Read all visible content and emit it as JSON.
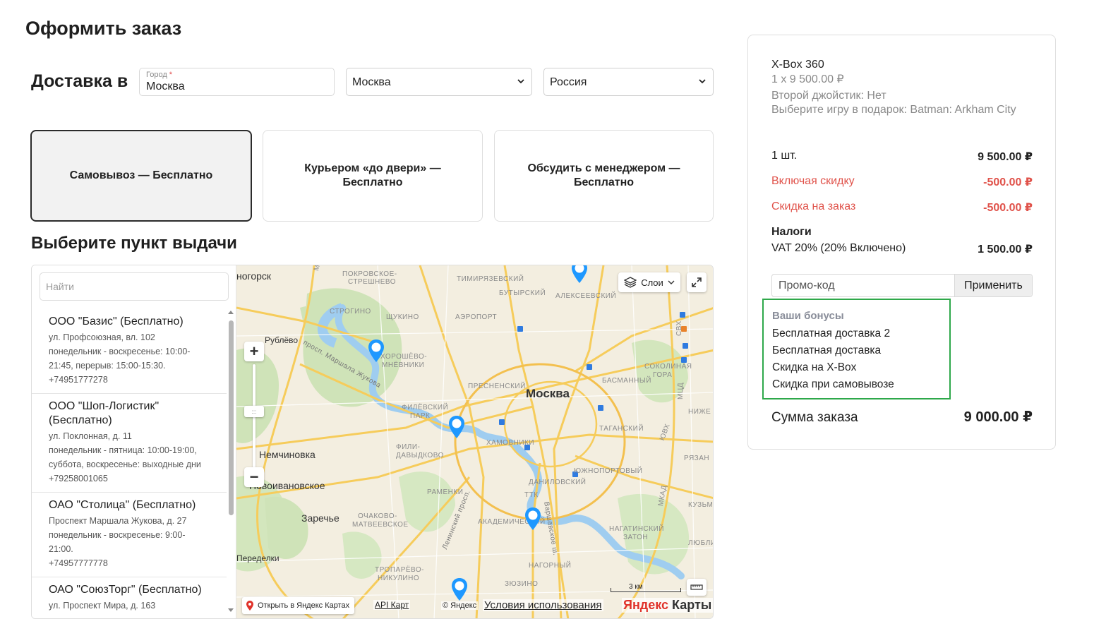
{
  "page_title": "Оформить заказ",
  "delivery": {
    "label": "Доставка в",
    "city_label": "Город",
    "city_required_mark": "*",
    "city_value": "Москва",
    "region_value": "Москва",
    "country_value": "Россия"
  },
  "delivery_options": [
    {
      "label": "Самовывоз — Бесплатно",
      "selected": true
    },
    {
      "label": "Курьером «до двери» — Бесплатно",
      "selected": false
    },
    {
      "label": "Обсудить с менеджером — Бесплатно",
      "selected": false
    }
  ],
  "pickup": {
    "title": "Выберите пункт выдачи",
    "search_placeholder": "Найти",
    "points": [
      {
        "name": "ООО \"Базис\" (Бесплатно)",
        "lines": [
          "ул. Профсоюзная, вл. 102",
          "понедельник - воскресенье: 10:00-",
          "21:45, перерыв: 15:00-15:30.",
          "+74951777278"
        ]
      },
      {
        "name": "ООО \"Шоп-Логистик\" (Бесплатно)",
        "lines": [
          "ул. Поклонная, д. 11",
          "понедельник - пятница: 10:00-19:00,",
          "суббота, воскресенье: выходные дни",
          "+79258001065"
        ]
      },
      {
        "name": "ОАО \"Столица\" (Бесплатно)",
        "lines": [
          "Проспект Маршала Жукова, д. 27",
          "понедельник - воскресенье: 9:00-",
          "21:00.",
          "+74957777778"
        ]
      },
      {
        "name": "ОАО \"СоюзТорг\" (Бесплатно)",
        "lines": [
          "ул. Проспект Мира, д. 163"
        ]
      }
    ]
  },
  "map": {
    "layers_label": "Слои",
    "zoom_in": "+",
    "zoom_out": "−",
    "open_in_yandex": "Открыть в Яндекс Картах",
    "api_link": "API Карт",
    "copyright": "© Яндекс",
    "terms": "Условия использования",
    "brand_y": "Яндекс",
    "brand_rest": " Карты",
    "scale_label": "3 км",
    "labels": {
      "city": "Москва",
      "nemchinovka": "Немчиновка",
      "novoivanovskoe": "Новоивановское",
      "zarechye": "Заречье",
      "rublevo": "Рублёво",
      "peredelki": "Переделки",
      "krasnogorsk": "ногорск",
      "mkad_west": "МКАД",
      "mkad_east": "МКАД",
      "pokrovskoe": "ПОКРОВСКОЕ-",
      "streshnevo": "СТРЕШНЕВО",
      "timiryazevsky": "ТИМИРЯЗЕВСКИЙ",
      "butyrsky": "БУТЫРСКИЙ",
      "alekseevsky": "АЛЕКСЕЕВСКИЙ",
      "strogino": "СТРОГИНО",
      "shchukino": "ЩУКИНО",
      "airport": "АЭРОПОРТ",
      "marshala_zhukova": "просп. Маршала Жукова",
      "horoshevo": "ХОРОШЁВО-",
      "mnevniki": "МНЁВНИКИ",
      "presnensky": "ПРЕСНЕНСКИЙ",
      "basmanny": "БАСМАННЫЙ",
      "sokolinaya": "СОКОЛИНАЯ",
      "gora": "ГОРА",
      "filevsky": "ФИЛЁВСКИЙ",
      "park": "ПАРК",
      "tagansky": "ТАГАНСКИЙ",
      "fili": "ФИЛИ-",
      "davydkovo": "ДАВЫДКОВО",
      "khamovniki": "ХАМОВНИКИ",
      "danilovsky": "ДАНИЛОВСКИЙ",
      "yuzhnoportovy": "ЮЖНОПОРТОВЫЙ",
      "ramenki": "РАМЕНКИ",
      "ttk": "ТТК",
      "akademichesky": "АКАДЕМИЧЕСКИЙ",
      "ochakovo": "ОЧАКОВО-",
      "matveevskoe": "МАТВЕЕВСКОЕ",
      "nagatinsky": "НАГАТИНСКИЙ",
      "zaton": "ЗАТОН",
      "leninsky": "Ленинский просп.",
      "varshavskoe": "Варшавское ш.",
      "troparevo": "ТРОПАРЁВО-",
      "nikulino": "НИКУЛИНО",
      "nagorny": "НАГОРНЫЙ",
      "zyuzino": "ЗЮЗИНО",
      "svh": "СВХ",
      "yuv": "ЮВХ",
      "mcd": "МЦД",
      "ryazansky": "РЯЗАН",
      "kuzminki": "КУЗЬМ",
      "lyublino": "ЛЮБЛИ",
      "nizhegorodsky": "НИЖЕ"
    }
  },
  "summary": {
    "product_name": "X-Box 360",
    "product_price_line": "1 x 9 500.00 ₽",
    "option1": "Второй джойстик: Нет",
    "option2": "Выберите игру в подарок: Batman: Arkham City",
    "qty_label": "1 шт.",
    "qty_value": "9 500.00 ₽",
    "discount_label": "Включая скидку",
    "discount_value": "-500.00 ₽",
    "order_discount_label": "Скидка на заказ",
    "order_discount_value": "-500.00 ₽",
    "taxes_title": "Налоги",
    "vat_label": "VAT 20% (20% Включено)",
    "vat_value": "1 500.00 ₽",
    "promo_placeholder": "Промо-код",
    "promo_apply": "Применить",
    "bonuses_title": "Ваши бонусы",
    "bonuses": [
      "Бесплатная доставка 2",
      "Бесплатная доставка",
      "Скидка на X-Box",
      "Скидка при самовывозе"
    ],
    "total_label": "Сумма заказа",
    "total_value": "9 000.00 ₽"
  },
  "colors": {
    "accent_red": "#e0524a",
    "bonus_border": "#2ea84a",
    "pin_blue": "#1e98ff"
  }
}
